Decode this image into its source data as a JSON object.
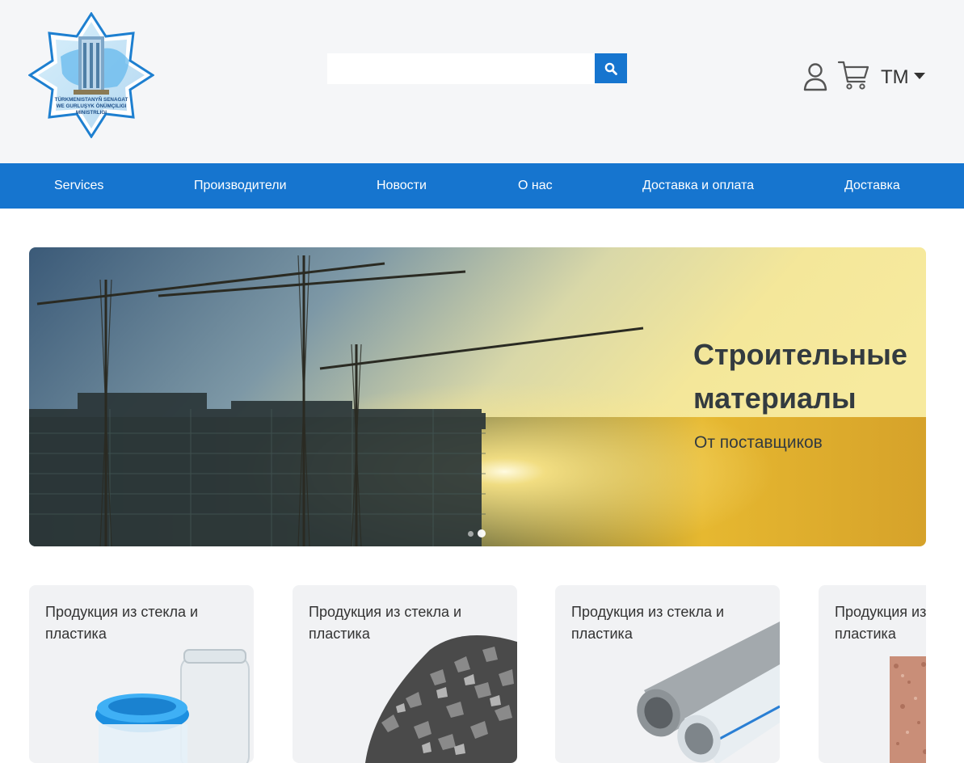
{
  "header": {
    "logo_text_line1": "TÜRKMENISTANYŇ SENAGAT",
    "logo_text_line2": "WE GURLUŞYK ÖNÜMÇILIGI",
    "logo_text_line3": "MINISTRLIGI",
    "search": {
      "placeholder": "",
      "value": ""
    },
    "icons": {
      "search": "search-icon",
      "user": "user-icon",
      "cart": "cart-icon"
    },
    "language": "TM"
  },
  "nav": {
    "items": [
      {
        "label": "Services"
      },
      {
        "label": "Производители"
      },
      {
        "label": "Новости"
      },
      {
        "label": "О нас"
      },
      {
        "label": "Доставка и оплата"
      },
      {
        "label": "Доставка"
      }
    ]
  },
  "hero": {
    "title": "Строительные материалы",
    "subtitle": "От поставщиков",
    "slides": 2,
    "active_slide": 2
  },
  "categories": [
    {
      "title": "Продукция из стекла и пластика",
      "image": "plastic-jars"
    },
    {
      "title": "Продукция из стекла и пластика",
      "image": "gravel"
    },
    {
      "title": "Продукция из стекла и пластика",
      "image": "pipes"
    },
    {
      "title": "Продукция из стекла и пластика",
      "image": "granite-tile"
    }
  ],
  "colors": {
    "primary": "#1675cf",
    "header_bg": "#f5f6f8",
    "card_bg": "#f1f2f4",
    "text": "#333333"
  }
}
